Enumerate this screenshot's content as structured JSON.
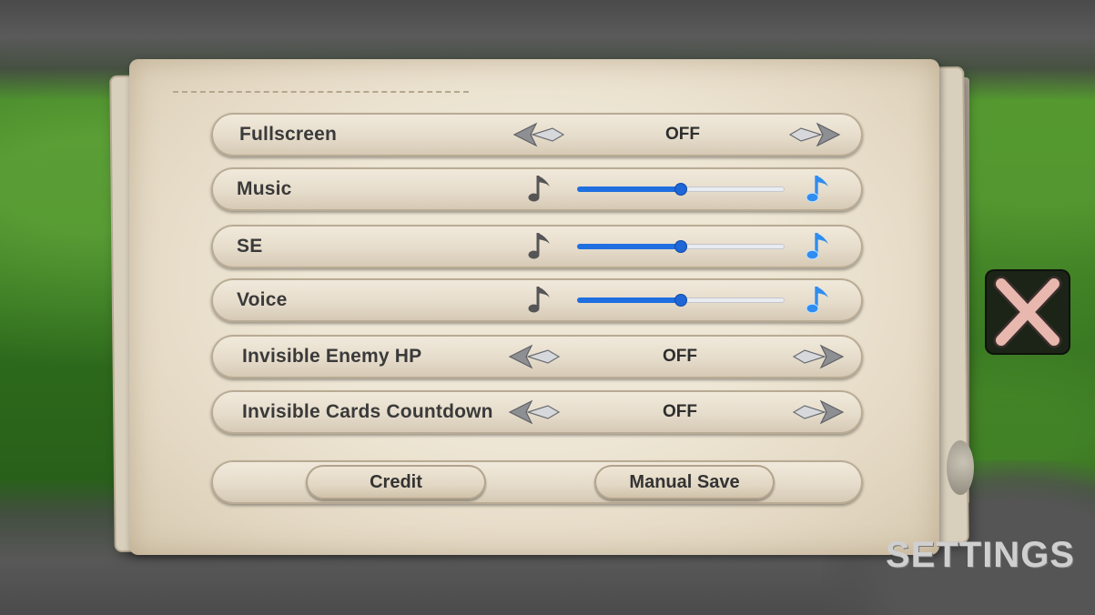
{
  "screen_title": "SETTINGS",
  "settings": [
    {
      "label": "Fullscreen",
      "type": "toggle",
      "value": "OFF"
    },
    {
      "label": "Music",
      "type": "slider",
      "level_percent": 50
    },
    {
      "label": "SE",
      "type": "slider",
      "level_percent": 50
    },
    {
      "label": "Voice",
      "type": "slider",
      "level_percent": 50
    },
    {
      "label": "Invisible Enemy HP",
      "type": "toggle",
      "value": "OFF"
    },
    {
      "label": "Invisible Cards Countdown",
      "type": "toggle",
      "value": "OFF"
    }
  ],
  "buttons": {
    "credit": "Credit",
    "manual_save": "Manual Save"
  },
  "icons": {
    "arrow_left": "arrow-left-icon",
    "arrow_right": "arrow-right-icon",
    "volume_low": "music-note-icon",
    "volume_high": "music-note-blue-icon",
    "close": "close-icon"
  },
  "colors": {
    "slider_fill": "#1f6fe0",
    "note_high": "#3aa0ff",
    "close_x": "#e8b7ad"
  }
}
